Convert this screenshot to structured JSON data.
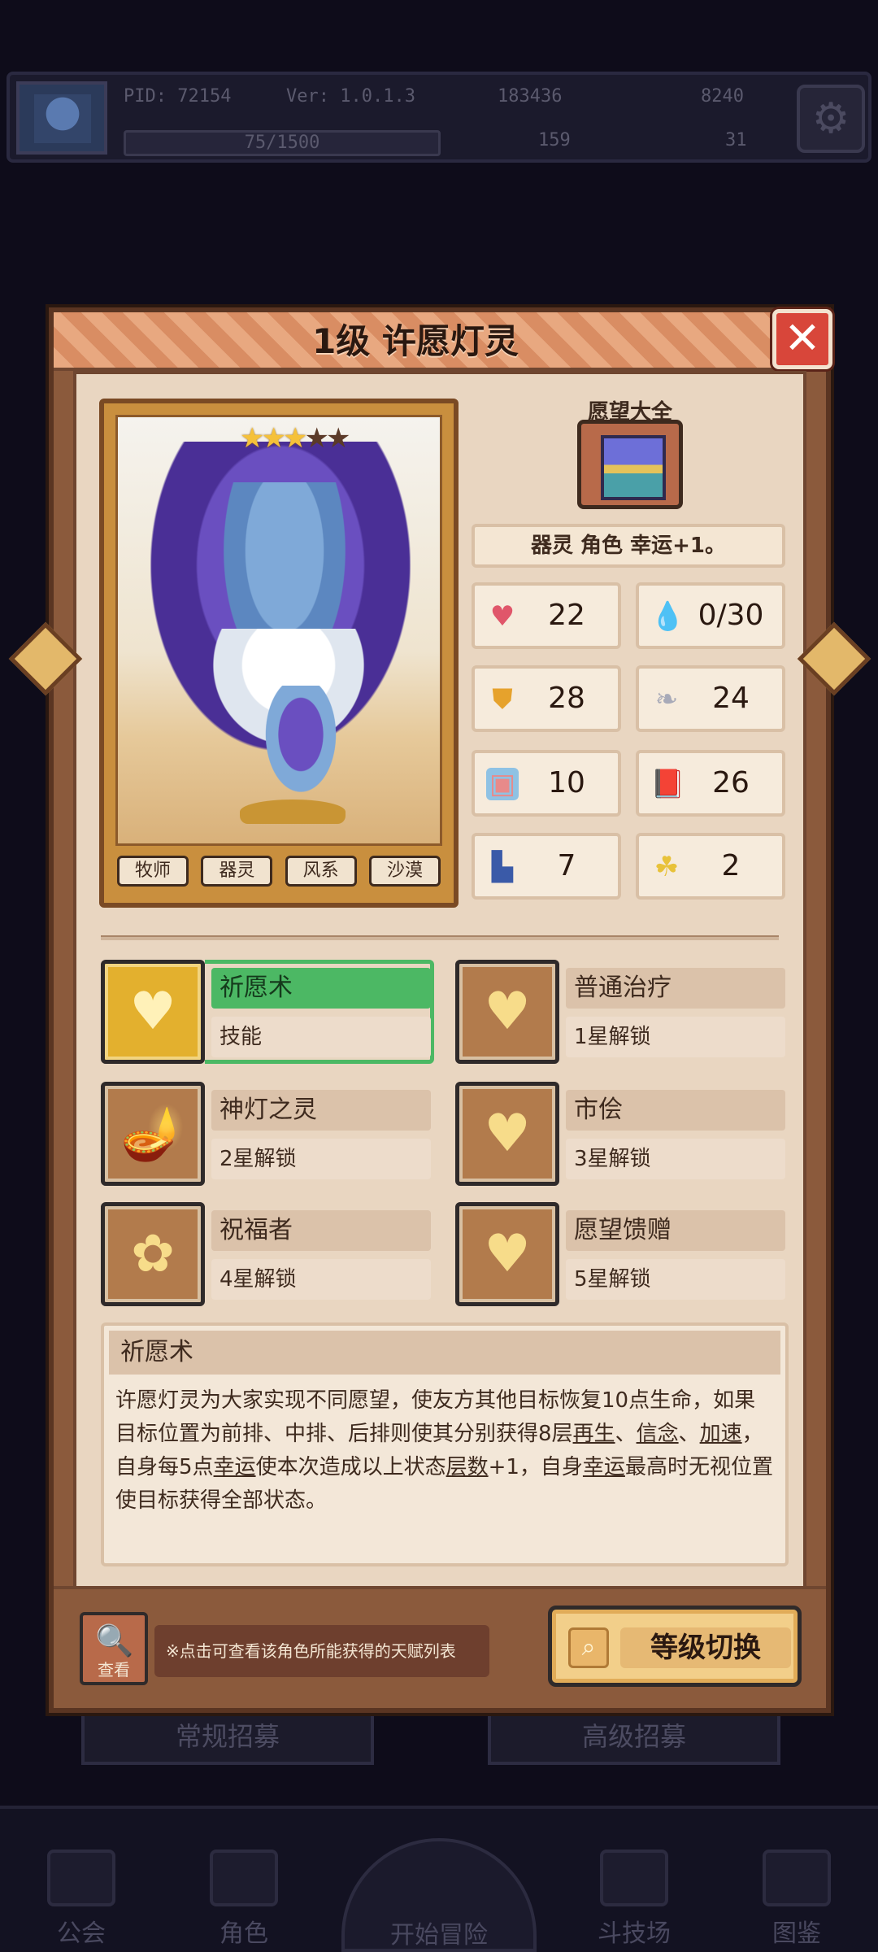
{
  "background": {
    "pid": "PID: 72154",
    "version": "Ver: 1.0.1.3",
    "exp": "75/1500",
    "gold": "183436",
    "gems": "8240",
    "res_a": "159",
    "res_b": "31",
    "btn_left": "常规招募",
    "btn_right": "高级招募",
    "nav": [
      "公会",
      "角色",
      "开始冒险",
      "斗技场",
      "图鉴"
    ]
  },
  "dialog": {
    "title": "1级 许愿灯灵",
    "close_icon": "close-icon"
  },
  "character": {
    "stars_filled": 3,
    "stars_total": 5,
    "tags": [
      "牧师",
      "器灵",
      "风系",
      "沙漠"
    ]
  },
  "item": {
    "label": "愿望大全",
    "icon": "treasure-chest-icon"
  },
  "passive": "器灵 角色 幸运+1。",
  "stats": [
    {
      "icon": "heart-icon",
      "value": "22"
    },
    {
      "icon": "water-drop-icon",
      "value": "0/30"
    },
    {
      "icon": "shield-icon",
      "value": "28"
    },
    {
      "icon": "feather-icon",
      "value": "24"
    },
    {
      "icon": "rune-icon",
      "value": "10"
    },
    {
      "icon": "book-icon",
      "value": "26"
    },
    {
      "icon": "boot-icon",
      "value": "7"
    },
    {
      "icon": "clover-icon",
      "value": "2"
    }
  ],
  "skills": [
    {
      "name": "祈愿术",
      "sub": "技能",
      "icon": "heart-shield-icon",
      "active": true
    },
    {
      "name": "普通治疗",
      "sub": "1星解锁",
      "icon": "heart-shield-icon"
    },
    {
      "name": "神灯之灵",
      "sub": "2星解锁",
      "icon": "magic-lamp-icon"
    },
    {
      "name": "市侩",
      "sub": "3星解锁",
      "icon": "heart-shield-icon"
    },
    {
      "name": "祝福者",
      "sub": "4星解锁",
      "icon": "blessing-icon"
    },
    {
      "name": "愿望馈赠",
      "sub": "5星解锁",
      "icon": "heart-shield-icon"
    }
  ],
  "description": {
    "title": "祈愿术",
    "text_1": "许愿灯灵为大家实现不同愿望，使友方其他目标恢复10点生命，如果目标位置为前排、中排、后排则使其分别获得8层",
    "kw_1": "再生",
    "sep_1": "、",
    "kw_2": "信念",
    "sep_2": "、",
    "kw_3": "加速",
    "text_2": "，自身每5点",
    "kw_4": "幸运",
    "text_3": "使本次造成以上状态",
    "kw_5": "层数",
    "text_4": "+1，自身",
    "kw_6": "幸运",
    "text_5": "最高时无视位置使目标获得全部状态。"
  },
  "footer": {
    "view_label": "查看",
    "hint": "※点击可查看该角色所能获得的天赋列表",
    "switch_label": "等级切换"
  }
}
